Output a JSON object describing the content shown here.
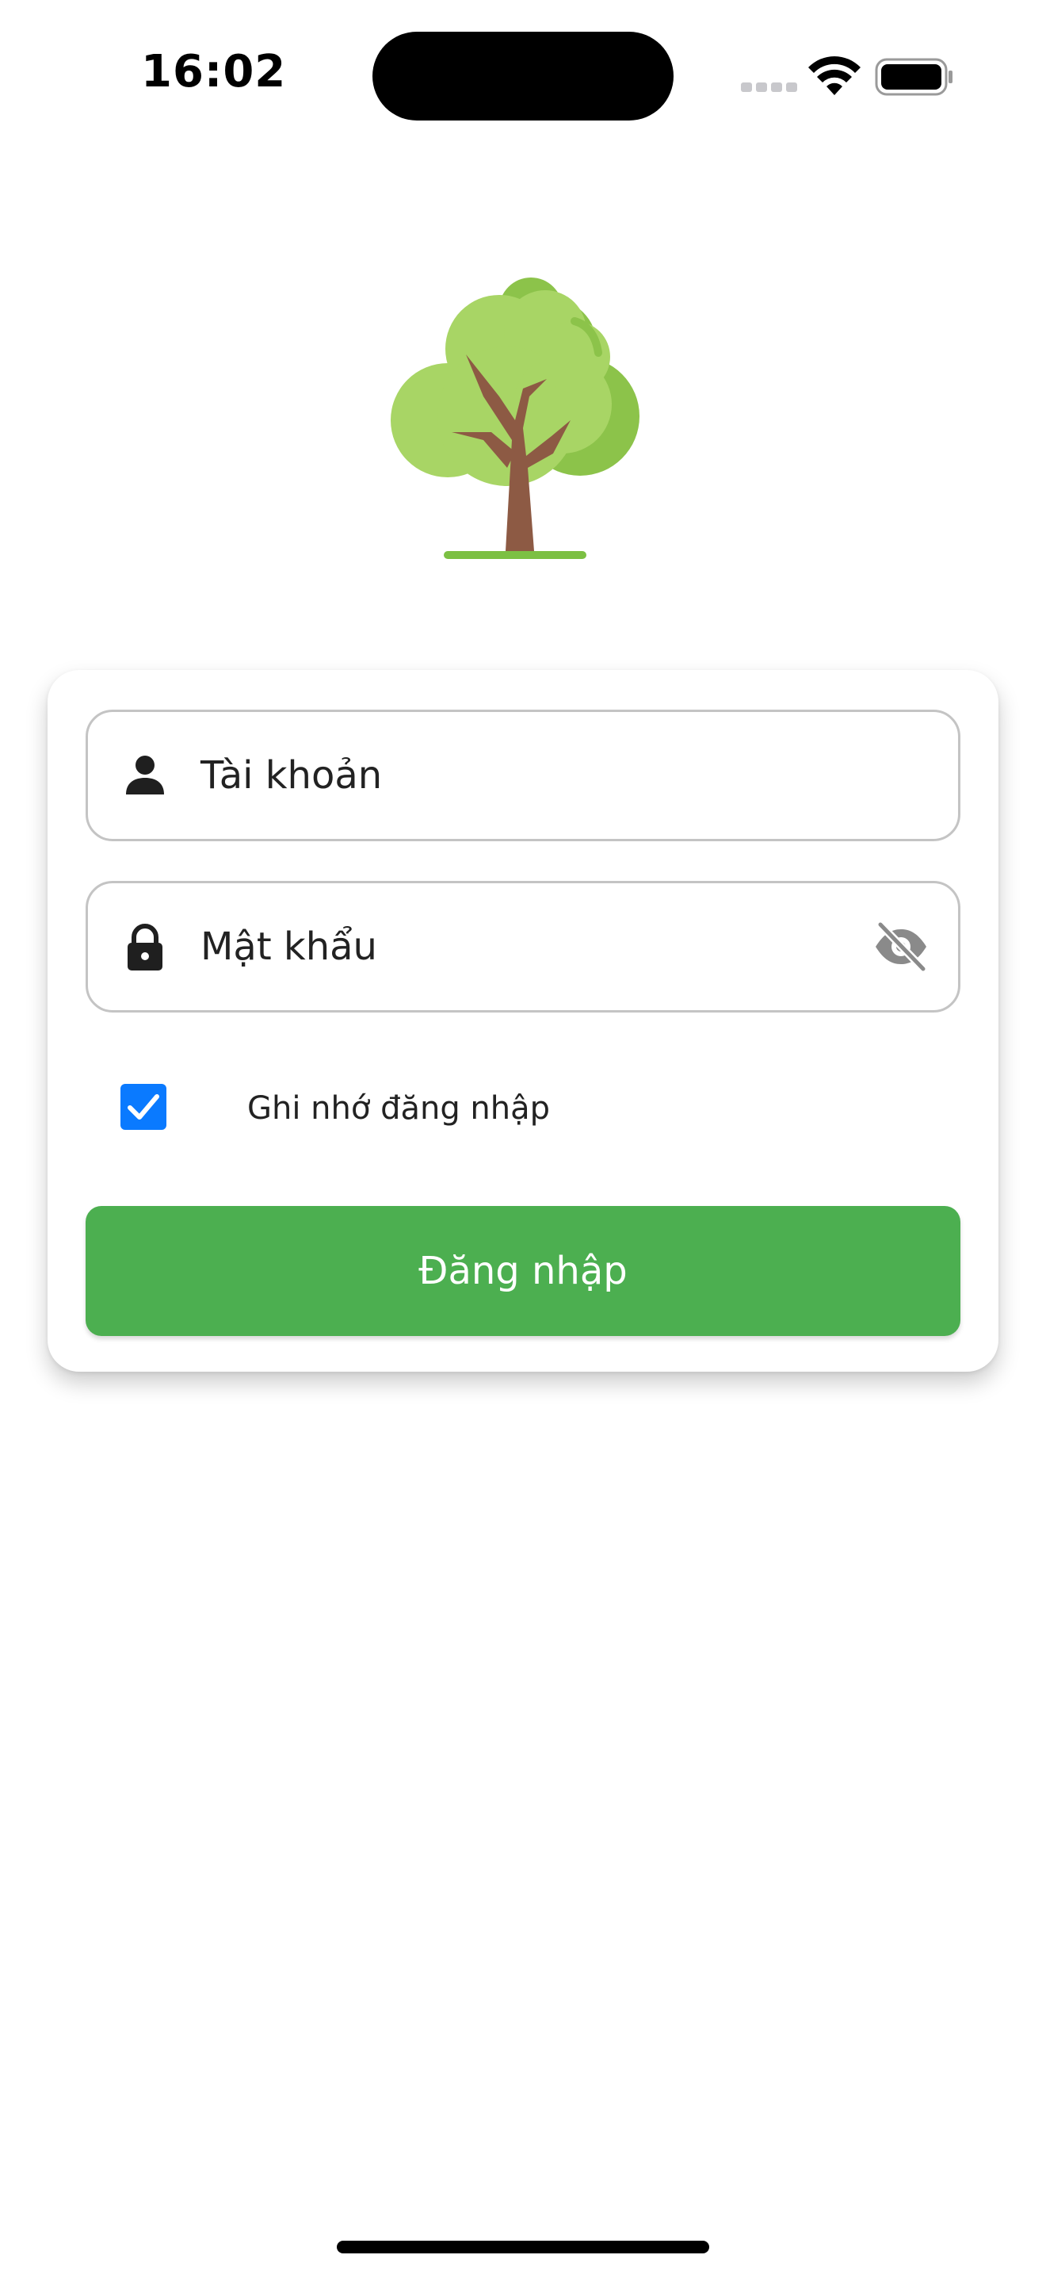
{
  "status_bar": {
    "time": "16:02",
    "icons": [
      "cellular-signal-icon",
      "wifi-icon",
      "battery-icon"
    ]
  },
  "logo": {
    "icon": "tree-icon",
    "colors": {
      "foliage_light": "#a8d565",
      "foliage_dark": "#8cc34a",
      "trunk": "#8d5a44",
      "ground": "#7cc043"
    }
  },
  "login_form": {
    "username": {
      "icon": "user-icon",
      "placeholder": "Tài khoản",
      "value": ""
    },
    "password": {
      "icon": "lock-icon",
      "placeholder": "Mật khẩu",
      "value": "",
      "visibility_toggle_icon": "eye-off-icon"
    },
    "remember_me": {
      "label": "Ghi nhớ đăng nhập",
      "checked": true
    },
    "submit_label": "Đăng nhập"
  },
  "colors": {
    "primary_button": "#4caf50",
    "checkbox": "#0a7aff",
    "field_border": "#c4c4c4",
    "text": "#222222"
  }
}
